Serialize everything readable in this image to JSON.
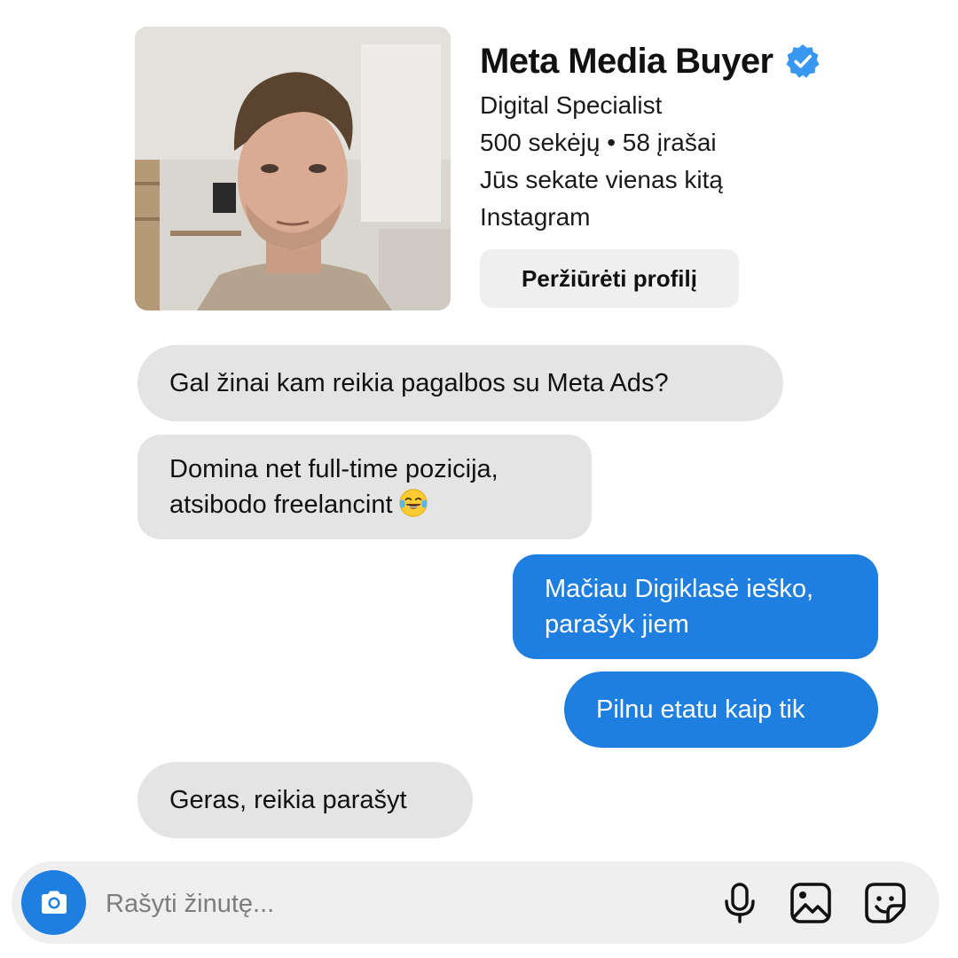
{
  "profile": {
    "name": "Meta Media Buyer",
    "verified": true,
    "subtitle": "Digital Specialist",
    "stats": "500 sekėjų • 58 įrašai",
    "relationship": "Jūs sekate vienas kitą",
    "platform": "Instagram",
    "view_profile_label": "Peržiūrėti profilį",
    "photo_icon": "profile-photo"
  },
  "messages": [
    {
      "direction": "received",
      "text": "Gal žinai kam reikia pagalbos su Meta Ads?"
    },
    {
      "direction": "received",
      "text": "Domina net full-time pozicija,\natsibodo freelancint",
      "emoji": "face-with-tears-of-joy"
    },
    {
      "direction": "sent",
      "text": "Mačiau Digiklasė ieško,\nparašyk jiem"
    },
    {
      "direction": "sent",
      "text": "Pilnu etatu kaip tik"
    },
    {
      "direction": "received",
      "text": "Geras, reikia parašyt"
    }
  ],
  "composer": {
    "placeholder": "Rašyti žinutę...",
    "icons": [
      "camera-icon",
      "microphone-icon",
      "gallery-icon",
      "sticker-icon"
    ]
  },
  "colors": {
    "sent_bubble": "#1f7fe0",
    "received_bubble": "#e4e4e4",
    "verified_badge": "#3897f0",
    "composer_bg": "#efefef"
  }
}
